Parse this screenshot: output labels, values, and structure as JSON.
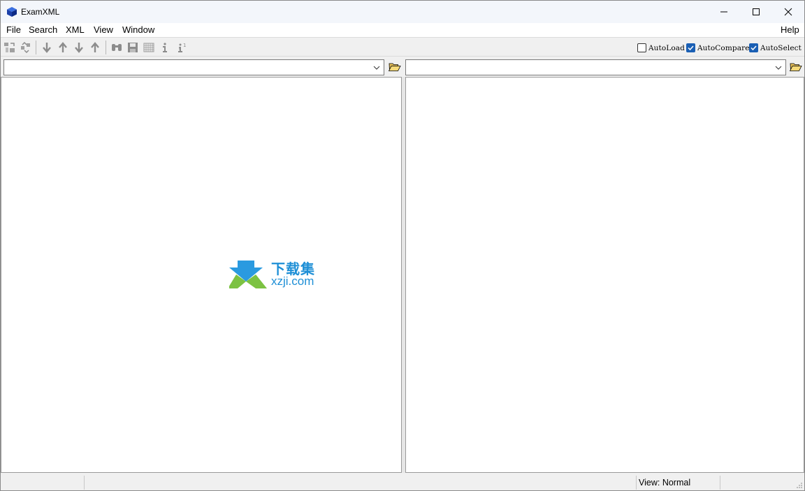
{
  "window": {
    "title": "ExamXML"
  },
  "menu": {
    "items": [
      "File",
      "Search",
      "XML",
      "View",
      "Window"
    ],
    "help": "Help"
  },
  "toolbar": {
    "icons": [
      "compare-icon",
      "compare-refresh-icon",
      "next-difference-icon",
      "previous-difference-icon",
      "next-icon",
      "previous-icon",
      "find-icon",
      "save-icon",
      "table-icon",
      "info-icon",
      "statistics-icon"
    ],
    "options": [
      {
        "label": "AutoLoad",
        "checked": false
      },
      {
        "label": "AutoCompare",
        "checked": true
      },
      {
        "label": "AutoSelect",
        "checked": true
      }
    ]
  },
  "left": {
    "path_value": ""
  },
  "right": {
    "path_value": ""
  },
  "watermark": {
    "cn": "下载集",
    "en": "xzji.com"
  },
  "status": {
    "view": "View: Normal"
  },
  "colors": {
    "accent": "#1a5fb4",
    "watermark_blue": "#1e8fd6",
    "watermark_green": "#7cc242"
  }
}
